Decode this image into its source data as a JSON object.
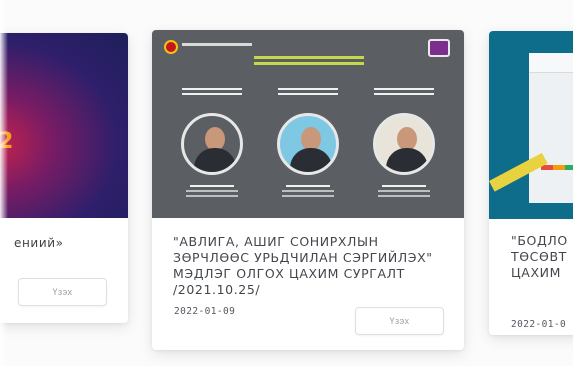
{
  "cards": [
    {
      "id": "left",
      "title": "ениий»",
      "accent_text": "2",
      "button_label": "Үзэх",
      "colors": {
        "thumb_start": "#c8234b",
        "thumb_end": "#1d1f5a",
        "accent": "#f7a41d"
      }
    },
    {
      "id": "center",
      "title": "\"АВЛИГА, АШИГ СОНИРХЛЫН ЗӨРЧЛӨӨС УРЬДЧИЛАН СЭРГИЙЛЭХ\" МЭДЛЭГ ОЛГОХ ЦАХИМ СУРГАЛТ /2021.10.25/",
      "date": "2022-01-09",
      "button_label": "Үзэх",
      "colors": {
        "thumb": "#5b5f63",
        "banner": "#c7d74a",
        "logo_left": "#c5161d",
        "logo_right": "#7b2e8c"
      },
      "speakers": 3
    },
    {
      "id": "right",
      "title": "\"БОДЛО\nТӨСӨВТ\nЦАХИМ",
      "date": "2022-01-0",
      "colors": {
        "thumb": "#0f6d8c",
        "stripe": "#e9d23f"
      }
    }
  ]
}
